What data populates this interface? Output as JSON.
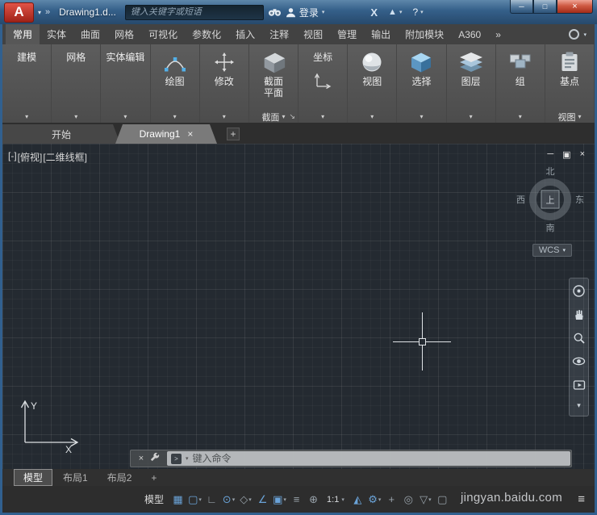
{
  "glyphs": {
    "down_arrow": "▾",
    "launcher_arrow": "↘",
    "overflow": "»",
    "plus": "+",
    "close": "×",
    "minimize": "─",
    "maximize": "□",
    "restore": "▣",
    "menu": "≡",
    "prompt": ">"
  },
  "titlebar": {
    "logo_letter": "A",
    "doc_title": "Drawing1.d...",
    "search_placeholder": "键入关键字或短语",
    "signin_label": "登录",
    "exchange_label": "X",
    "a360_glyph": "▲",
    "help_label": "?"
  },
  "ribbon": {
    "tabs": [
      {
        "label": "常用",
        "active": true,
        "name": "ribbon-tab-home"
      },
      {
        "label": "实体",
        "name": "ribbon-tab-solid"
      },
      {
        "label": "曲面",
        "name": "ribbon-tab-surface"
      },
      {
        "label": "网格",
        "name": "ribbon-tab-mesh"
      },
      {
        "label": "可视化",
        "name": "ribbon-tab-visualize"
      },
      {
        "label": "参数化",
        "name": "ribbon-tab-parametric"
      },
      {
        "label": "插入",
        "name": "ribbon-tab-insert"
      },
      {
        "label": "注释",
        "name": "ribbon-tab-annotate"
      },
      {
        "label": "视图",
        "name": "ribbon-tab-view"
      },
      {
        "label": "管理",
        "name": "ribbon-tab-manage"
      },
      {
        "label": "输出",
        "name": "ribbon-tab-output"
      },
      {
        "label": "附加模块",
        "name": "ribbon-tab-addins"
      },
      {
        "label": "A360",
        "name": "ribbon-tab-a360"
      },
      {
        "label": "»",
        "name": "ribbon-tab-overflow"
      }
    ],
    "panels": {
      "modeling": {
        "label": "建模"
      },
      "mesh": {
        "label": "网格"
      },
      "solid_editing": {
        "label": "实体编辑"
      },
      "draw": {
        "label": "绘图"
      },
      "modify": {
        "label": "修改"
      },
      "section": {
        "line1": "截面",
        "line2": "平面",
        "footer": "截面"
      },
      "coordinates": {
        "label": "坐标"
      },
      "view": {
        "label": "视图"
      },
      "selection": {
        "label": "选择"
      },
      "layers": {
        "label": "图层"
      },
      "groups": {
        "label": "组"
      },
      "base": {
        "label": "基点",
        "footer": "视图"
      }
    }
  },
  "file_tabs": {
    "start_label": "开始",
    "drawing_label": "Drawing1"
  },
  "viewport": {
    "control_minus": "[-]",
    "control_view": "[俯视]",
    "control_style": "[二维线框]",
    "viewcube": {
      "north": "北",
      "south": "南",
      "west": "西",
      "east": "东",
      "top_face": "上"
    },
    "wcs_label": "WCS"
  },
  "ucs": {
    "x_label": "X",
    "y_label": "Y"
  },
  "command_line": {
    "placeholder": "键入命令"
  },
  "layout_tabs": [
    {
      "label": "模型",
      "active": true,
      "name": "layout-tab-model"
    },
    {
      "label": "布局1",
      "name": "layout-tab-layout1"
    },
    {
      "label": "布局2",
      "name": "layout-tab-layout2"
    },
    {
      "label": "+",
      "name": "new-layout-button"
    }
  ],
  "status_bar": {
    "model_label": "模型",
    "icons": [
      {
        "name": "grid-icon",
        "glyph": "▦",
        "tone": "blue"
      },
      {
        "name": "snap-icon",
        "glyph": "▢",
        "arrow": "▾",
        "tone": "blue"
      },
      {
        "name": "ortho-icon",
        "glyph": "∟",
        "tone": "gray"
      },
      {
        "name": "polar-tracking-icon",
        "glyph": "⊙",
        "arrow": "▾",
        "tone": "blue"
      },
      {
        "name": "isometric-drafting-icon",
        "glyph": "◇",
        "arrow": "▾",
        "tone": "gray"
      },
      {
        "name": "object-snap-tracking-icon",
        "glyph": "∠",
        "tone": "blue"
      },
      {
        "name": "object-snap-icon",
        "glyph": "▣",
        "arrow": "▾",
        "tone": "blue"
      },
      {
        "name": "lineweight-icon",
        "glyph": "≡",
        "tone": "gray"
      },
      {
        "name": "dynamic-input-icon",
        "glyph": "⊕",
        "tone": "gray"
      }
    ],
    "scale_label": "1:1",
    "right_icons": [
      {
        "name": "annotation-visibility-icon",
        "glyph": "◭",
        "tone": "blue"
      },
      {
        "name": "workspace-gear-icon",
        "glyph": "⚙",
        "arrow": "▾",
        "tone": "blue"
      },
      {
        "name": "annotation-monitor-icon",
        "glyph": "+",
        "tone": "gray"
      },
      {
        "name": "isolate-objects-icon",
        "glyph": "◎",
        "tone": "gray"
      },
      {
        "name": "filter-icon",
        "glyph": "▽",
        "arrow": "▾",
        "tone": "gray"
      },
      {
        "name": "clean-screen-icon",
        "glyph": "▢",
        "tone": "gray"
      }
    ],
    "watermark": "jingyan.baidu.com"
  }
}
